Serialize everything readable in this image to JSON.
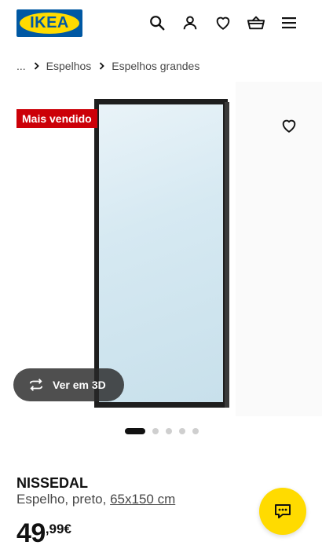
{
  "brand": {
    "logo_text": "IKEA",
    "blue": "#0058a3",
    "yellow": "#ffdb00"
  },
  "header": {
    "icons": [
      "search-icon",
      "user-icon",
      "heart-icon",
      "basket-icon",
      "menu-icon"
    ]
  },
  "breadcrumb": {
    "ellipsis": "...",
    "items": [
      "Espelhos",
      "Espelhos grandes"
    ]
  },
  "gallery": {
    "badge": "Mais vendido",
    "badge_color": "#cc0008",
    "view_3d_label": "Ver em 3D",
    "slide_count": 5,
    "active_slide": 1
  },
  "product": {
    "name": "NISSEDAL",
    "description": "Espelho, preto, ",
    "dimensions": "65x150 cm",
    "price_integer": "49",
    "price_decimal": ",99€"
  },
  "chat": {
    "icon": "chat-icon"
  }
}
